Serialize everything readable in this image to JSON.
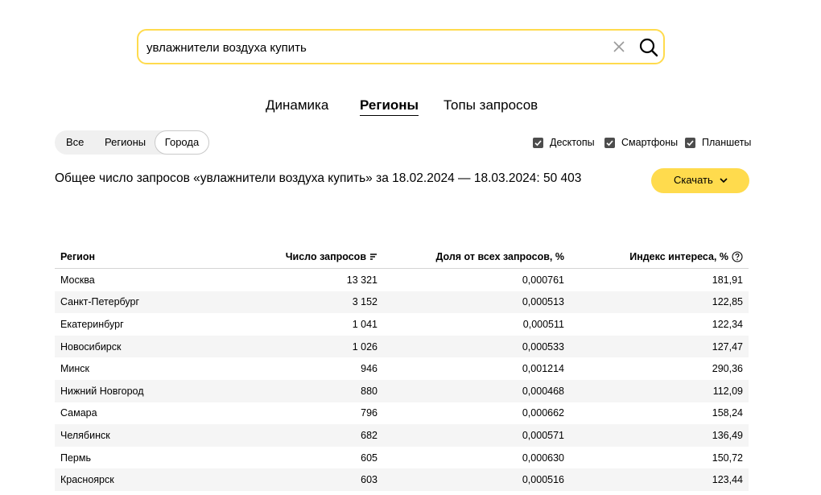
{
  "search": {
    "query": "увлажнители воздуха купить"
  },
  "nav": {
    "tabs": [
      "Динамика",
      "Регионы",
      "Топы запросов"
    ],
    "active": "Регионы"
  },
  "filter": {
    "options": [
      "Все",
      "Регионы",
      "Города"
    ],
    "active": "Города"
  },
  "devices": [
    {
      "label": "Десктопы",
      "checked": true
    },
    {
      "label": "Смартфоны",
      "checked": true
    },
    {
      "label": "Планшеты",
      "checked": true
    }
  ],
  "total_text": "Общее число запросов «увлажнители воздуха купить» за 18.02.2024 — 18.03.2024: 50 403",
  "download_label": "Скачать",
  "table": {
    "headers": [
      "Регион",
      "Число запросов",
      "Доля от всех запросов, %",
      "Индекс интереса, %"
    ],
    "rows": [
      [
        "Москва",
        "13 321",
        "0,000761",
        "181,91"
      ],
      [
        "Санкт-Петербург",
        "3 152",
        "0,000513",
        "122,85"
      ],
      [
        "Екатеринбург",
        "1 041",
        "0,000511",
        "122,34"
      ],
      [
        "Новосибирск",
        "1 026",
        "0,000533",
        "127,47"
      ],
      [
        "Минск",
        "946",
        "0,001214",
        "290,36"
      ],
      [
        "Нижний Новгород",
        "880",
        "0,000468",
        "112,09"
      ],
      [
        "Самара",
        "796",
        "0,000662",
        "158,24"
      ],
      [
        "Челябинск",
        "682",
        "0,000571",
        "136,49"
      ],
      [
        "Пермь",
        "605",
        "0,000630",
        "150,72"
      ],
      [
        "Красноярск",
        "603",
        "0,000516",
        "123,44"
      ]
    ]
  },
  "colors": {
    "accent": "#ffdb4d",
    "checkbox": "#4d4d4d",
    "row_stripe": "#f5f5f5"
  }
}
